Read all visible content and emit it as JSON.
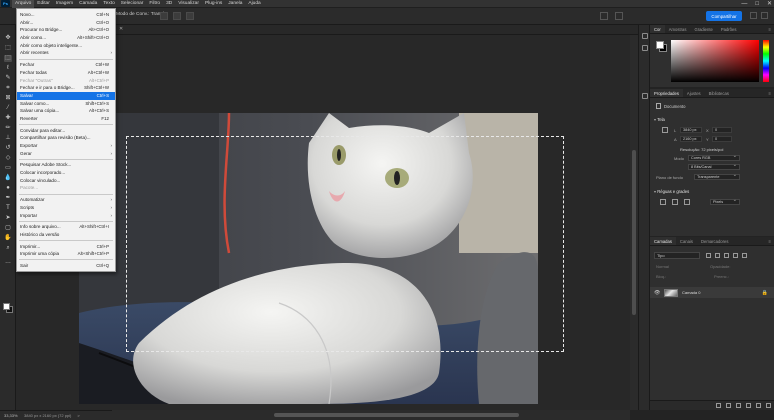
{
  "menubar": {
    "items": [
      "Arquivo",
      "Editar",
      "Imagem",
      "Camada",
      "Texto",
      "Selecionar",
      "Filtro",
      "3D",
      "Visualizar",
      "Plug-ins",
      "Janela",
      "Ajuda"
    ],
    "active_index": 0,
    "window_controls": {
      "minimize": "—",
      "maximize": "□",
      "close": "✕"
    }
  },
  "options_bar": {
    "mode_label": "Modo de Conv.: Transl.",
    "share_label": "Compartilhar"
  },
  "file_menu": {
    "items": [
      {
        "label": "Novo...",
        "shortcut": "Ctrl+N"
      },
      {
        "label": "Abrir...",
        "shortcut": "Ctrl+O"
      },
      {
        "label": "Procurar no Bridge...",
        "shortcut": "Alt+Ctrl+O"
      },
      {
        "label": "Abrir como...",
        "shortcut": "Alt+Shift+Ctrl+O"
      },
      {
        "label": "Abrir como objeto inteligente...",
        "shortcut": ""
      },
      {
        "label": "Abrir recentes",
        "shortcut": "",
        "submenu": true
      },
      {
        "sep": true
      },
      {
        "label": "Fechar",
        "shortcut": "Ctrl+W"
      },
      {
        "label": "Fechar todas",
        "shortcut": "Alt+Ctrl+W"
      },
      {
        "label": "Fechar \"Outras\"",
        "shortcut": "Alt+Ctrl+P",
        "disabled": true
      },
      {
        "label": "Fechar e ir para o Bridge...",
        "shortcut": "Shift+Ctrl+W"
      },
      {
        "label": "Salvar",
        "shortcut": "Ctrl+S",
        "highlighted": true
      },
      {
        "label": "Salvar como...",
        "shortcut": "Shift+Ctrl+S"
      },
      {
        "label": "Salvar uma cópia...",
        "shortcut": "Alt+Ctrl+S"
      },
      {
        "label": "Reverter",
        "shortcut": "F12"
      },
      {
        "sep": true
      },
      {
        "label": "Convidar para editar...",
        "shortcut": ""
      },
      {
        "label": "Compartilhar para revisão (Beta)...",
        "shortcut": ""
      },
      {
        "label": "Exportar",
        "shortcut": "",
        "submenu": true
      },
      {
        "label": "Gerar",
        "shortcut": "",
        "submenu": true
      },
      {
        "sep": true
      },
      {
        "label": "Pesquisar Adobe Stock...",
        "shortcut": ""
      },
      {
        "label": "Colocar incorporado...",
        "shortcut": ""
      },
      {
        "label": "Colocar vinculado...",
        "shortcut": ""
      },
      {
        "label": "Pacote...",
        "shortcut": "",
        "disabled": true
      },
      {
        "sep": true
      },
      {
        "label": "Automatizar",
        "shortcut": "",
        "submenu": true
      },
      {
        "label": "Scripts",
        "shortcut": "",
        "submenu": true
      },
      {
        "label": "Importar",
        "shortcut": "",
        "submenu": true
      },
      {
        "sep": true
      },
      {
        "label": "Info sobre arquivo...",
        "shortcut": "Alt+Shift+Ctrl+I"
      },
      {
        "label": "Histórico da versão",
        "shortcut": ""
      },
      {
        "sep": true
      },
      {
        "label": "Imprimir...",
        "shortcut": "Ctrl+P"
      },
      {
        "label": "Imprimir uma cópia",
        "shortcut": "Alt+Shift+Ctrl+P"
      },
      {
        "sep": true
      },
      {
        "label": "Sair",
        "shortcut": "Ctrl+Q"
      }
    ]
  },
  "status_bar": {
    "zoom": "33,33%",
    "doc_info": "3840 px x 2160 px (72 ppi)",
    "chevron": ">"
  },
  "color_panel": {
    "tabs": [
      "Cor",
      "Amostras",
      "Gradiente",
      "Padrões"
    ],
    "active_tab": 0
  },
  "properties_panel": {
    "tabs": [
      "Propriedades",
      "Ajustes",
      "Bibliotecas"
    ],
    "doc_label": "Documento",
    "canvas_section": "Tela",
    "width_label": "L",
    "width_value": "3840 px",
    "height_label": "A",
    "height_value": "2160 px",
    "x_label": "X",
    "x_value": "0",
    "y_label": "Y",
    "y_value": "0",
    "resolution": "Resolução: 72 pixels/pol",
    "mode_label": "Modo",
    "mode_value": "Cores RGB",
    "depth_value": "8 Bits/Canal",
    "bg_label": "Plano de fundo",
    "bg_value": "Transparente",
    "rulers_section": "Réguas e grades",
    "pixels_value": "Pixels"
  },
  "layers_panel": {
    "tabs": [
      "Camadas",
      "Canais",
      "Demarcadores"
    ],
    "filter_value": "Tipo",
    "blend_label": "Normal",
    "opacity_label": "Opacidade:",
    "lock_label": "Bloq.:",
    "fill_label": "Preenc.:",
    "layer_name": "Camada 0"
  },
  "icons": {
    "eye": "👁",
    "lock": "🔒",
    "menu": "≡",
    "close": "✕",
    "submenu_arrow": "›"
  }
}
